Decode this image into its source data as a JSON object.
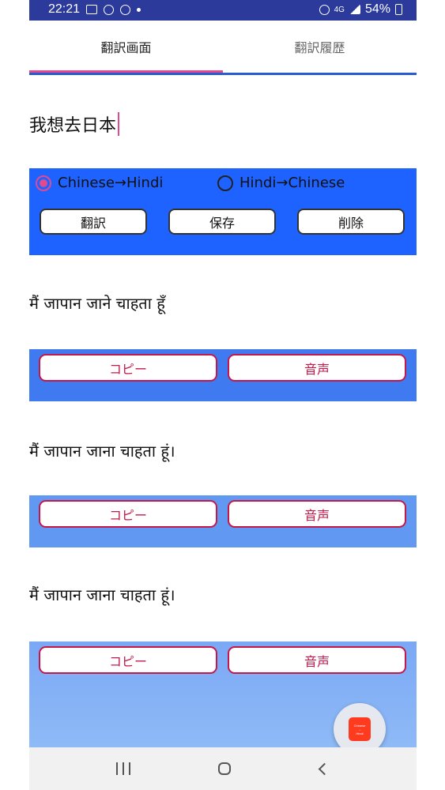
{
  "status_bar": {
    "time": "22:21",
    "network": "4G",
    "battery": "54%"
  },
  "tabs": [
    {
      "label": "翻訳画面",
      "selected": true
    },
    {
      "label": "翻訳履歴",
      "selected": false
    }
  ],
  "input": {
    "value": "我想去日本"
  },
  "direction": {
    "options": [
      {
        "label": "Chinese→Hindi",
        "selected": true
      },
      {
        "label": "Hindi→Chinese",
        "selected": false
      }
    ]
  },
  "actions": {
    "translate": "翻訳",
    "save": "保存",
    "delete": "削除"
  },
  "results": [
    {
      "text": "मैं जापान जाने चाहता हूँ",
      "copy": "コピー",
      "voice": "音声"
    },
    {
      "text": "मैं जापान जाना चाहता हूं।",
      "copy": "コピー",
      "voice": "音声"
    },
    {
      "text": "मैं जापान जाना चाहता हूं।",
      "copy": "コピー",
      "voice": "音声"
    }
  ],
  "fab": {
    "line1": "Chinese",
    "line2": "→",
    "line3": "Hindi"
  },
  "colors": {
    "status_bar": "#2b3a9b",
    "panel": "#1e63ff",
    "accent": "#e04a8f",
    "result_button_border": "#c4184a",
    "result_bar_1": "#3f7af0",
    "result_bar_2": "#6098f2",
    "result_bar_3_top": "#7aa8f5",
    "result_bar_3_bottom": "#8fbaf7"
  }
}
